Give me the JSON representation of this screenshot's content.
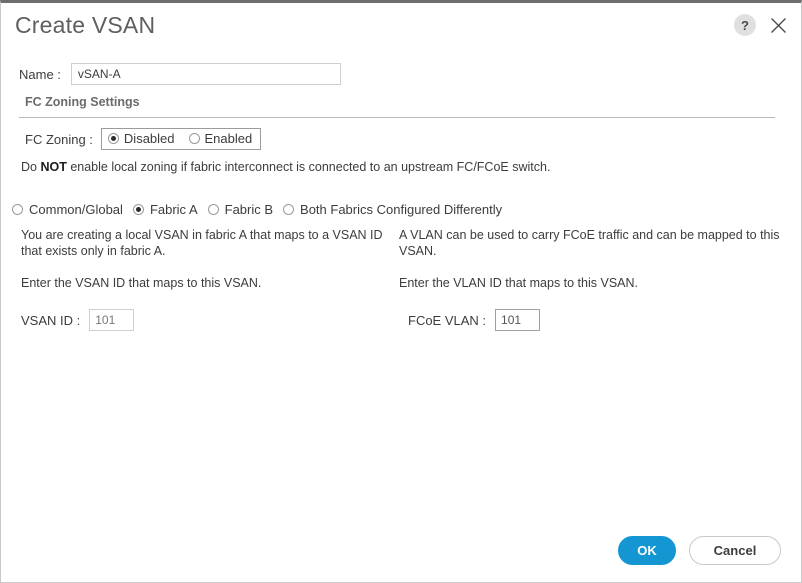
{
  "dialog": {
    "title": "Create VSAN",
    "help_icon": "help-question-icon",
    "close_icon": "close-x-icon"
  },
  "name_field": {
    "label": "Name :",
    "value": "vSAN-A",
    "placeholder": ""
  },
  "fc_zoning_section": {
    "title": "FC Zoning Settings",
    "label": "FC Zoning :",
    "options": [
      {
        "label": "Disabled",
        "checked": true
      },
      {
        "label": "Enabled",
        "checked": false
      }
    ],
    "warning_prefix": "Do ",
    "warning_bold": "NOT",
    "warning_suffix": " enable local zoning if fabric interconnect is connected to an upstream FC/FCoE switch."
  },
  "fabric_options": [
    {
      "label": "Common/Global",
      "checked": false
    },
    {
      "label": "Fabric A",
      "checked": true
    },
    {
      "label": "Fabric B",
      "checked": false
    },
    {
      "label": "Both Fabrics Configured Differently",
      "checked": false
    }
  ],
  "left_column": {
    "description": "You are creating a local VSAN in fabric A that maps to a VSAN ID that exists only in fabric A.",
    "instruction": "Enter the VSAN ID that maps to this VSAN.",
    "id_label": "VSAN ID :",
    "id_value": "101"
  },
  "right_column": {
    "description": "A VLAN can be used to carry FCoE traffic and can be mapped to this VSAN.",
    "instruction": "Enter the VLAN ID that maps to this VSAN.",
    "id_label": "FCoE VLAN :",
    "id_value": "101"
  },
  "footer": {
    "ok_label": "OK",
    "cancel_label": "Cancel"
  },
  "colors": {
    "accent": "#1496d3",
    "title_text": "#5f5f5f",
    "body_text": "#3c3c3c",
    "border": "#c9c9c9",
    "top_bar": "#6e6e6e"
  }
}
